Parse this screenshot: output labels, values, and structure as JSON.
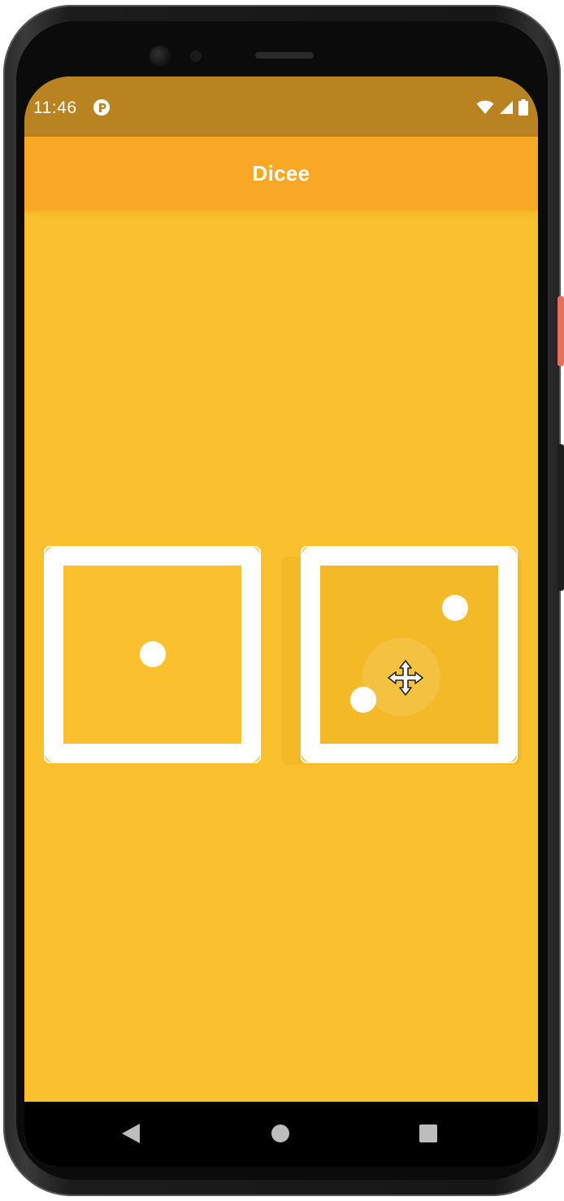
{
  "status_bar": {
    "time": "11:46",
    "app_icon": "app-notification-icon",
    "icons": [
      "wifi-icon",
      "cellular-signal-icon",
      "battery-icon"
    ]
  },
  "app_bar": {
    "title": "Dicee"
  },
  "dice": [
    {
      "name": "left-dice",
      "face": 1
    },
    {
      "name": "right-dice",
      "face": 2
    }
  ],
  "colors": {
    "background": "#fbc02d",
    "app_bar": "#f9a825",
    "status_bar": "#b88320",
    "dice": "#ffffff"
  },
  "cursor": {
    "icon": "move-cursor-icon"
  },
  "navigation": {
    "buttons": [
      "back-icon",
      "home-icon",
      "recents-icon"
    ]
  }
}
